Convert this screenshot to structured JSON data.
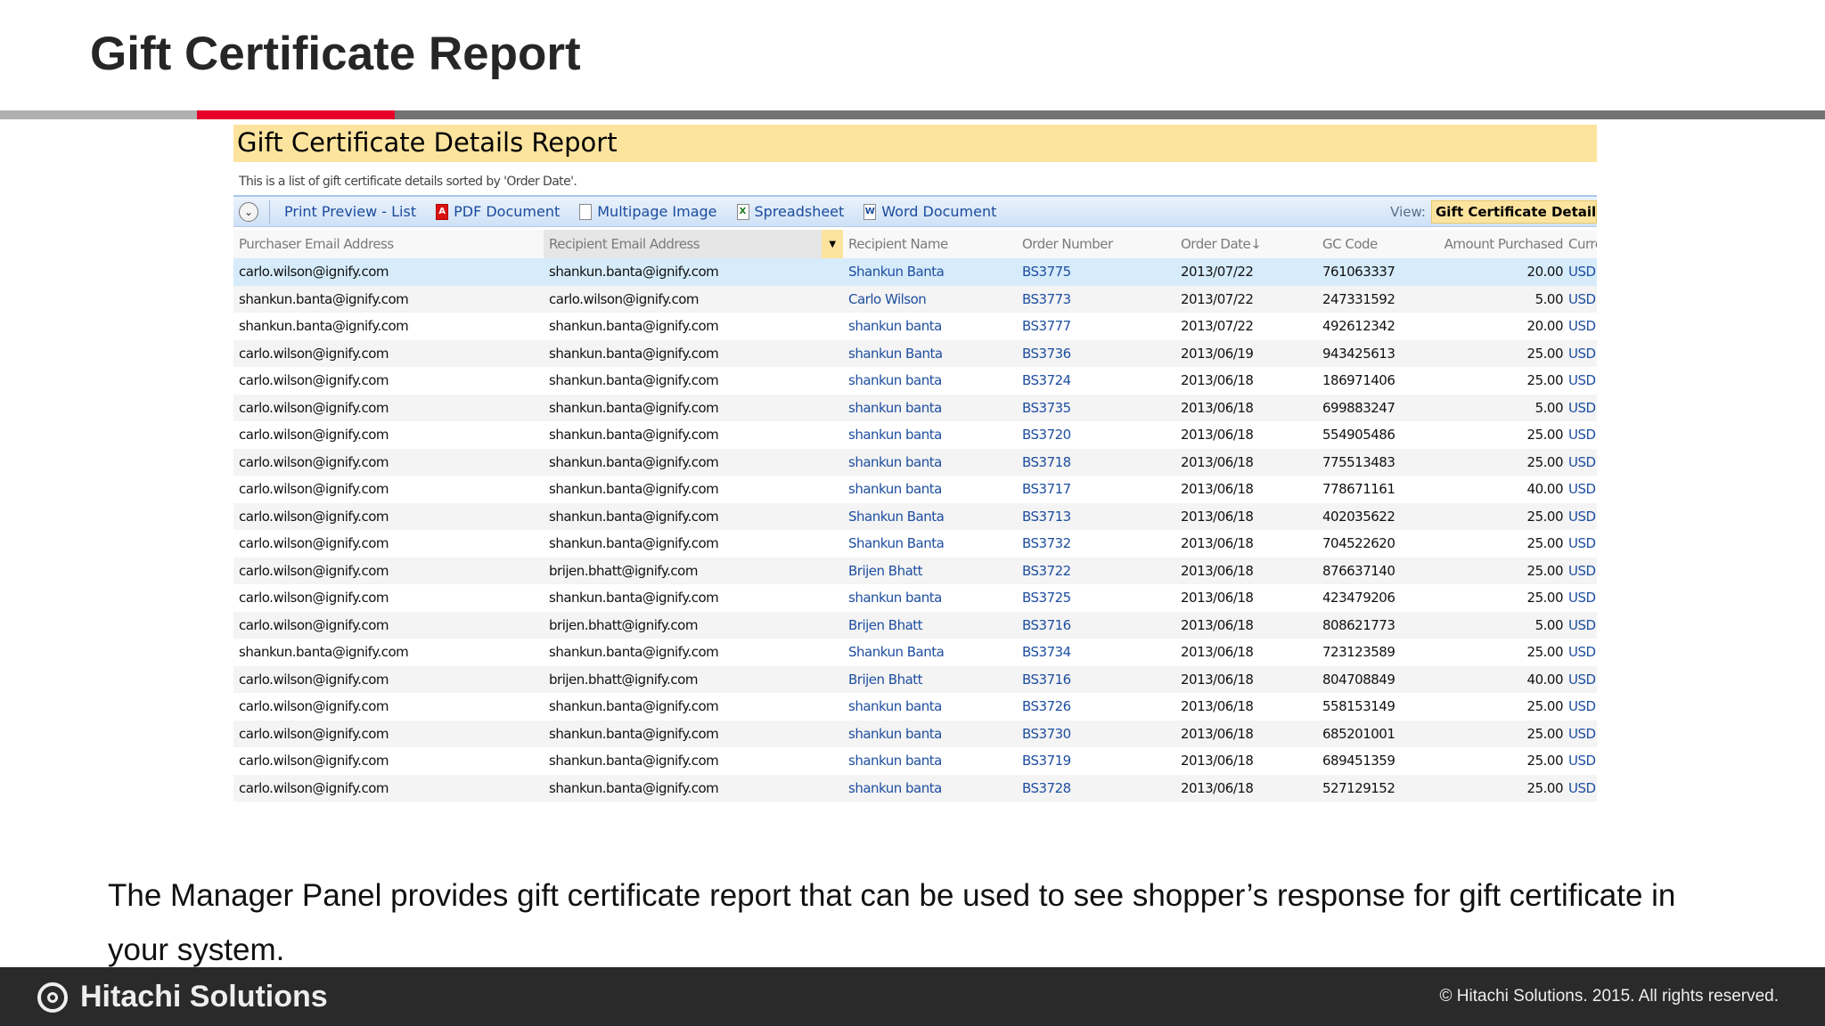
{
  "slide_title": "Gift Certificate Report",
  "report_title": "Gift Certificate Details Report",
  "report_subtitle": "This is a list of gift certificate details sorted by 'Order Date'.",
  "toolbar": {
    "print_preview": "Print Preview - List",
    "pdf": "PDF Document",
    "multipage": "Multipage Image",
    "spreadsheet": "Spreadsheet",
    "word": "Word Document",
    "view_label": "View:",
    "view_value": "Gift Certificate Details"
  },
  "columns": [
    "Purchaser Email Address",
    "Recipient Email Address",
    "Recipient Name",
    "Order Number",
    "Order Date↓",
    "GC Code",
    "Amount Purchased",
    "Currency"
  ],
  "rows": [
    [
      "carlo.wilson@ignify.com",
      "shankun.banta@ignify.com",
      "Shankun Banta",
      "BS3775",
      "2013/07/22",
      "761063337",
      "20.00",
      "USD"
    ],
    [
      "shankun.banta@ignify.com",
      "carlo.wilson@ignify.com",
      "Carlo Wilson",
      "BS3773",
      "2013/07/22",
      "247331592",
      "5.00",
      "USD"
    ],
    [
      "shankun.banta@ignify.com",
      "shankun.banta@ignify.com",
      "shankun banta",
      "BS3777",
      "2013/07/22",
      "492612342",
      "20.00",
      "USD"
    ],
    [
      "carlo.wilson@ignify.com",
      "shankun.banta@ignify.com",
      "shankun Banta",
      "BS3736",
      "2013/06/19",
      "943425613",
      "25.00",
      "USD"
    ],
    [
      "carlo.wilson@ignify.com",
      "shankun.banta@ignify.com",
      "shankun banta",
      "BS3724",
      "2013/06/18",
      "186971406",
      "25.00",
      "USD"
    ],
    [
      "carlo.wilson@ignify.com",
      "shankun.banta@ignify.com",
      "shankun banta",
      "BS3735",
      "2013/06/18",
      "699883247",
      "5.00",
      "USD"
    ],
    [
      "carlo.wilson@ignify.com",
      "shankun.banta@ignify.com",
      "shankun banta",
      "BS3720",
      "2013/06/18",
      "554905486",
      "25.00",
      "USD"
    ],
    [
      "carlo.wilson@ignify.com",
      "shankun.banta@ignify.com",
      "shankun banta",
      "BS3718",
      "2013/06/18",
      "775513483",
      "25.00",
      "USD"
    ],
    [
      "carlo.wilson@ignify.com",
      "shankun.banta@ignify.com",
      "shankun banta",
      "BS3717",
      "2013/06/18",
      "778671161",
      "40.00",
      "USD"
    ],
    [
      "carlo.wilson@ignify.com",
      "shankun.banta@ignify.com",
      "Shankun Banta",
      "BS3713",
      "2013/06/18",
      "402035622",
      "25.00",
      "USD"
    ],
    [
      "carlo.wilson@ignify.com",
      "shankun.banta@ignify.com",
      "Shankun Banta",
      "BS3732",
      "2013/06/18",
      "704522620",
      "25.00",
      "USD"
    ],
    [
      "carlo.wilson@ignify.com",
      "brijen.bhatt@ignify.com",
      "Brijen Bhatt",
      "BS3722",
      "2013/06/18",
      "876637140",
      "25.00",
      "USD"
    ],
    [
      "carlo.wilson@ignify.com",
      "shankun.banta@ignify.com",
      "shankun banta",
      "BS3725",
      "2013/06/18",
      "423479206",
      "25.00",
      "USD"
    ],
    [
      "carlo.wilson@ignify.com",
      "brijen.bhatt@ignify.com",
      "Brijen Bhatt",
      "BS3716",
      "2013/06/18",
      "808621773",
      "5.00",
      "USD"
    ],
    [
      "shankun.banta@ignify.com",
      "shankun.banta@ignify.com",
      "Shankun Banta",
      "BS3734",
      "2013/06/18",
      "723123589",
      "25.00",
      "USD"
    ],
    [
      "carlo.wilson@ignify.com",
      "brijen.bhatt@ignify.com",
      "Brijen Bhatt",
      "BS3716",
      "2013/06/18",
      "804708849",
      "40.00",
      "USD"
    ],
    [
      "carlo.wilson@ignify.com",
      "shankun.banta@ignify.com",
      "shankun banta",
      "BS3726",
      "2013/06/18",
      "558153149",
      "25.00",
      "USD"
    ],
    [
      "carlo.wilson@ignify.com",
      "shankun.banta@ignify.com",
      "shankun banta",
      "BS3730",
      "2013/06/18",
      "685201001",
      "25.00",
      "USD"
    ],
    [
      "carlo.wilson@ignify.com",
      "shankun.banta@ignify.com",
      "shankun banta",
      "BS3719",
      "2013/06/18",
      "689451359",
      "25.00",
      "USD"
    ],
    [
      "carlo.wilson@ignify.com",
      "shankun.banta@ignify.com",
      "shankun banta",
      "BS3728",
      "2013/06/18",
      "527129152",
      "25.00",
      "USD"
    ]
  ],
  "body_text": "The Manager Panel provides gift certificate report that can be used to see shopper’s response for gift certificate in your system.",
  "footer": {
    "logo_text": "Hitachi Solutions",
    "copyright": "©  Hitachi Solutions. 2015. All rights reserved."
  },
  "colors": {
    "accent_red": "#e60027",
    "banner_yellow": "#fde49e",
    "link_blue": "#1e4ea0",
    "footer_bg": "#2a2a2a"
  }
}
